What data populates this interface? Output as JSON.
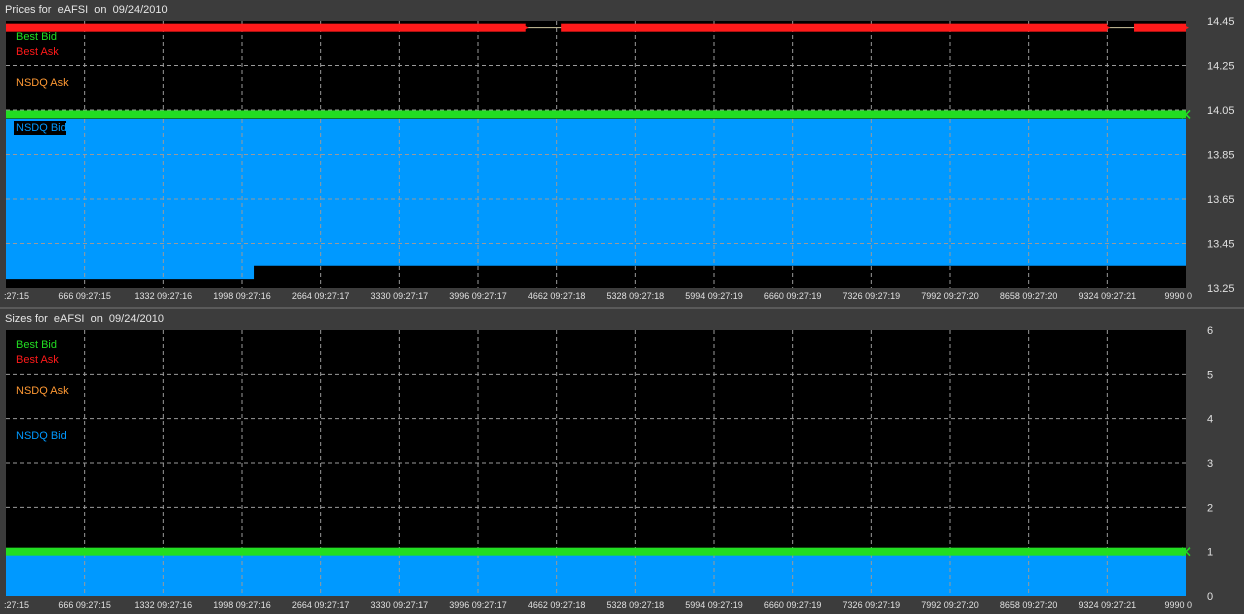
{
  "chart_data": [
    {
      "type": "area",
      "title": "Prices for  eAFSI  on  09/24/2010",
      "y_ticks": [
        "14.45",
        "14.25",
        "14.05",
        "13.85",
        "13.65",
        "13.45",
        "13.25"
      ],
      "ylim": [
        13.25,
        14.45
      ],
      "x_ticks": [
        ":27:15",
        "666 09:27:15",
        "1332 09:27:16",
        "1998 09:27:16",
        "2664 09:27:17",
        "3330 09:27:17",
        "3996 09:27:17",
        "4662 09:27:18",
        "5328 09:27:18",
        "5994 09:27:19",
        "6660 09:27:19",
        "7326 09:27:19",
        "7992 09:27:20",
        "8658 09:27:20",
        "9324 09:27:21",
        "9990 0"
      ],
      "xlim": [
        0,
        9990
      ],
      "grid": true,
      "legend_position": "top-left",
      "series": [
        {
          "name": "Best Bid",
          "color": "#22dd22",
          "points": [
            [
              0,
              14.03
            ],
            [
              9990,
              14.03
            ]
          ]
        },
        {
          "name": "Best Ask",
          "color": "#ff1a1a",
          "segments": [
            [
              [
                0,
                14.42
              ],
              [
                4400,
                14.42
              ]
            ],
            [
              [
                4700,
                14.42
              ],
              [
                9324,
                14.42
              ]
            ],
            [
              [
                9550,
                14.42
              ],
              [
                9990,
                14.42
              ]
            ]
          ]
        },
        {
          "name": "NSDQ Ask",
          "color": "#ff9933",
          "points": []
        },
        {
          "name": "NSDQ Bid",
          "color": "#0099ff",
          "steps": [
            [
              0,
              13.29
            ],
            [
              2100,
              13.29
            ],
            [
              2100,
              13.35
            ],
            [
              9990,
              13.35
            ]
          ],
          "fill_top": 14.01
        }
      ]
    },
    {
      "type": "area",
      "title": "Sizes for  eAFSI  on  09/24/2010",
      "y_ticks": [
        "6",
        "5",
        "4",
        "3",
        "2",
        "1",
        "0"
      ],
      "ylim": [
        0,
        6
      ],
      "x_ticks": [
        ":27:15",
        "666 09:27:15",
        "1332 09:27:16",
        "1998 09:27:16",
        "2664 09:27:17",
        "3330 09:27:17",
        "3996 09:27:17",
        "4662 09:27:18",
        "5328 09:27:18",
        "5994 09:27:19",
        "6660 09:27:19",
        "7326 09:27:19",
        "7992 09:27:20",
        "8658 09:27:20",
        "9324 09:27:21",
        "9990 0"
      ],
      "xlim": [
        0,
        9990
      ],
      "grid": true,
      "legend_position": "top-left",
      "series": [
        {
          "name": "Best Bid",
          "color": "#22dd22",
          "points": [
            [
              0,
              1
            ],
            [
              9990,
              1
            ]
          ]
        },
        {
          "name": "Best Ask",
          "color": "#ff1a1a",
          "points": []
        },
        {
          "name": "NSDQ Ask",
          "color": "#ff9933",
          "points": []
        },
        {
          "name": "NSDQ Bid",
          "color": "#0099ff",
          "points": [
            [
              0,
              0.95
            ],
            [
              9990,
              0.95
            ]
          ]
        }
      ]
    }
  ]
}
